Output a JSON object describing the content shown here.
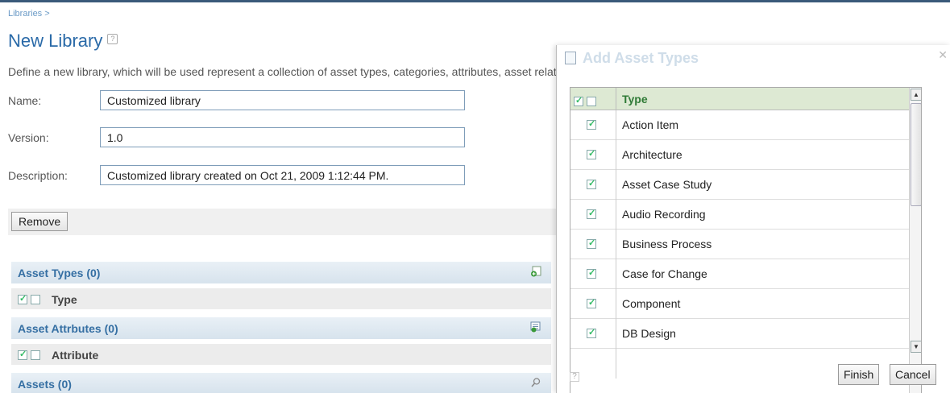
{
  "breadcrumb": "Libraries >",
  "page": {
    "title": "New Library",
    "help_icon": "help-icon",
    "description": "Define a new library, which will be used represent a collection of asset types, categories, attributes, asset relationships and assets."
  },
  "form": {
    "name_label": "Name:",
    "name_value": "Customized library",
    "version_label": "Version:",
    "version_value": "1.0",
    "description_label": "Description:",
    "description_value": "Customized library created on Oct 21, 2009 1:12:44 PM."
  },
  "toolbar": {
    "remove_label": "Remove"
  },
  "sections": {
    "asset_types": {
      "title": "Asset Types (0)",
      "column": "Type",
      "icon": "add-type-icon"
    },
    "asset_attributes": {
      "title": "Asset Attrbutes (0)",
      "column": "Attribute",
      "icon": "add-attribute-icon"
    },
    "assets": {
      "title": "Assets (0)",
      "icon": "search-icon"
    }
  },
  "dialog": {
    "title": "Add Asset Types",
    "close_icon": "close-icon",
    "column_header": "Type",
    "rows": [
      {
        "label": "Action Item",
        "checked": true
      },
      {
        "label": "Architecture",
        "checked": true
      },
      {
        "label": "Asset Case Study",
        "checked": true
      },
      {
        "label": "Audio Recording",
        "checked": true
      },
      {
        "label": "Business Process",
        "checked": true
      },
      {
        "label": "Case for Change",
        "checked": true
      },
      {
        "label": "Component",
        "checked": true
      },
      {
        "label": "DB Design",
        "checked": true
      }
    ],
    "finish_label": "Finish",
    "cancel_label": "Cancel"
  },
  "colors": {
    "accent": "#2a6aa8",
    "section_text": "#356fa3",
    "grid_header": "#dde9d3",
    "grid_header_text": "#2f7a36"
  }
}
